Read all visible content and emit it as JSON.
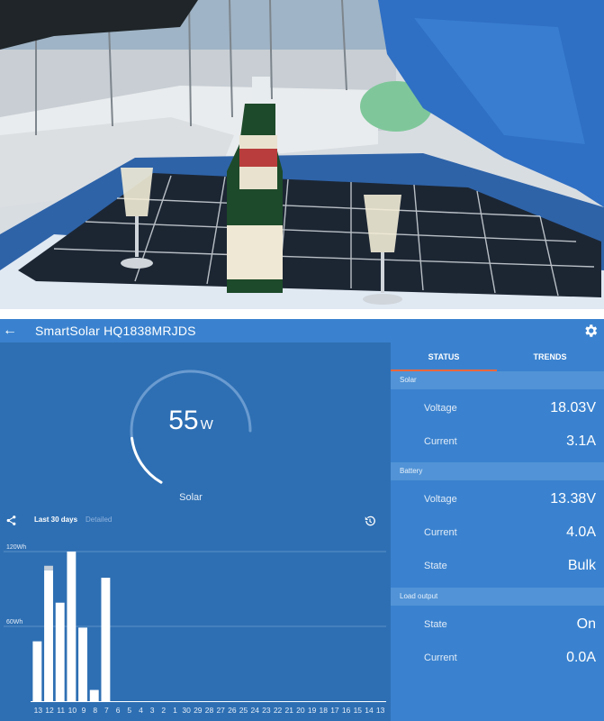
{
  "app": {
    "title": "SmartSolar HQ1838MRJDS"
  },
  "gauge": {
    "value": "55",
    "unit": "W",
    "label": "Solar",
    "fraction": 0.22
  },
  "chart_toolbar": {
    "tab_active": "Last 30 days",
    "tab_inactive": "Detailed"
  },
  "chart_data": {
    "type": "bar",
    "categories": [
      "13",
      "12",
      "11",
      "10",
      "9",
      "8",
      "7",
      "6",
      "5",
      "4",
      "3",
      "2",
      "1",
      "30",
      "29",
      "28",
      "27",
      "26",
      "25",
      "24",
      "23",
      "22",
      "21",
      "20",
      "19",
      "18",
      "17",
      "16",
      "15",
      "14",
      "13"
    ],
    "values": [
      48,
      105,
      79,
      120,
      59,
      9,
      99,
      0,
      0,
      0,
      0,
      0,
      0,
      0,
      0,
      0,
      0,
      0,
      0,
      0,
      0,
      0,
      0,
      0,
      0,
      0,
      0,
      0,
      0,
      0,
      0
    ],
    "ylim": [
      0,
      120
    ],
    "y_ticks": [
      "60Wh",
      "120Wh"
    ],
    "grid": true,
    "colors": {
      "bar": "#ffffff",
      "bar_cap": "#c3ced9",
      "grid": "#6a9bd0"
    }
  },
  "tabs": {
    "status": "STATUS",
    "trends": "TRENDS"
  },
  "sections": {
    "solar": {
      "title": "Solar",
      "voltage_label": "Voltage",
      "voltage_value": "18.03V",
      "current_label": "Current",
      "current_value": "3.1A"
    },
    "battery": {
      "title": "Battery",
      "voltage_label": "Voltage",
      "voltage_value": "13.38V",
      "current_label": "Current",
      "current_value": "4.0A",
      "state_label": "State",
      "state_value": "Bulk"
    },
    "load": {
      "title": "Load output",
      "state_label": "State",
      "state_value": "On",
      "current_label": "Current",
      "current_value": "0.0A"
    }
  },
  "colors": {
    "app_bar": "#3a82cf",
    "left_panel": "#2e6fb3",
    "accent_tab": "#f0673b",
    "gauge_track": "#6a9bd0",
    "gauge_fill": "#ffffff"
  }
}
